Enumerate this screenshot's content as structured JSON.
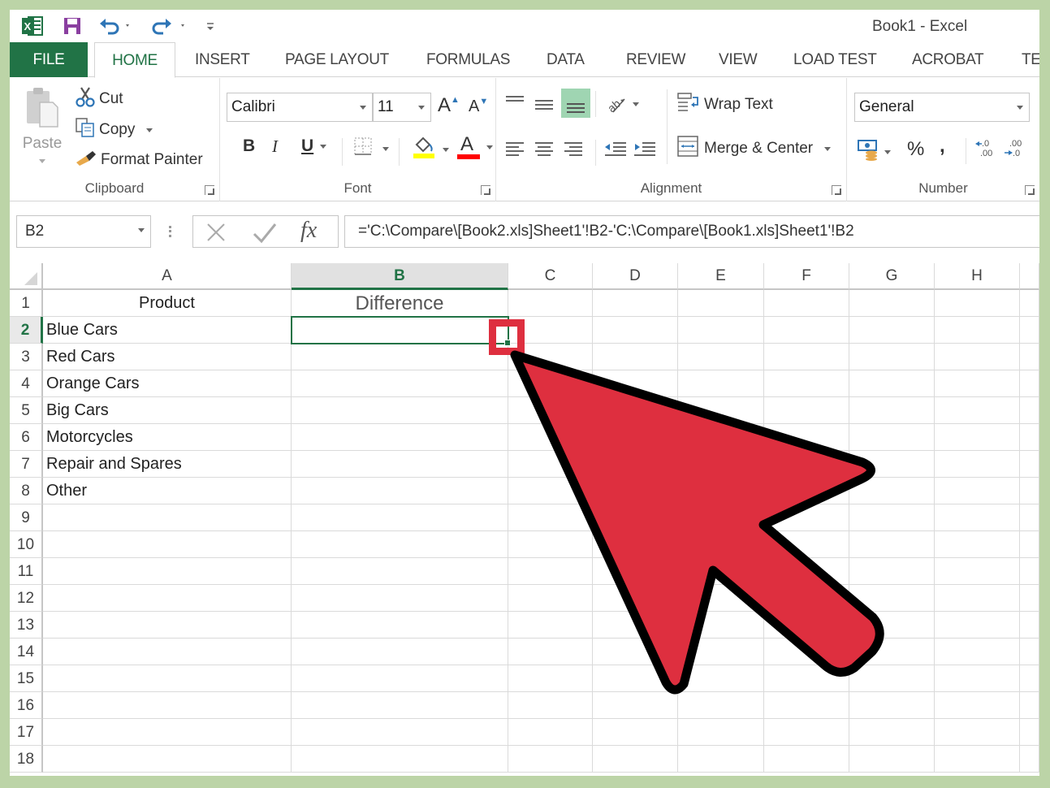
{
  "window": {
    "title": "Book1 - Excel"
  },
  "quick_access": {
    "app_icon": "excel-logo-icon",
    "items": [
      {
        "name": "save-icon"
      },
      {
        "name": "undo-icon"
      },
      {
        "name": "redo-icon"
      },
      {
        "name": "customize-qat-icon"
      }
    ]
  },
  "tabs": [
    {
      "label": "FILE"
    },
    {
      "label": "HOME",
      "active": true
    },
    {
      "label": "INSERT"
    },
    {
      "label": "PAGE LAYOUT"
    },
    {
      "label": "FORMULAS"
    },
    {
      "label": "DATA"
    },
    {
      "label": "REVIEW"
    },
    {
      "label": "VIEW"
    },
    {
      "label": "LOAD TEST"
    },
    {
      "label": "ACROBAT"
    },
    {
      "label": "TE"
    }
  ],
  "ribbon": {
    "clipboard": {
      "label": "Clipboard",
      "paste": "Paste",
      "cut": "Cut",
      "copy": "Copy",
      "format_painter": "Format Painter"
    },
    "font": {
      "label": "Font",
      "font_name": "Calibri",
      "font_size": "11",
      "bold": "B",
      "italic": "I",
      "underline": "U",
      "grow": "A",
      "shrink": "A",
      "font_color": "A",
      "highlight_color": "#ffff00",
      "text_color": "#ff0000"
    },
    "alignment": {
      "label": "Alignment",
      "wrap_text": "Wrap Text",
      "merge_center": "Merge & Center",
      "active_button": "bottom-align"
    },
    "number": {
      "label": "Number",
      "format": "General",
      "percent": "%",
      "comma": ","
    }
  },
  "formula_bar": {
    "name_box": "B2",
    "fx": "fx",
    "formula": "='C:\\Compare\\[Book2.xls]Sheet1'!B2-'C:\\Compare\\[Book1.xls]Sheet1'!B2"
  },
  "sheet": {
    "columns": [
      "A",
      "B",
      "C",
      "D",
      "E",
      "F",
      "G",
      "H"
    ],
    "selected_column": "B",
    "selected_row": 2,
    "active_cell": "B2",
    "rows": [
      {
        "n": "1",
        "A": "Product",
        "B": "Difference"
      },
      {
        "n": "2",
        "A": "Blue Cars",
        "B": ""
      },
      {
        "n": "3",
        "A": "Red Cars",
        "B": ""
      },
      {
        "n": "4",
        "A": "Orange Cars",
        "B": ""
      },
      {
        "n": "5",
        "A": "Big Cars",
        "B": ""
      },
      {
        "n": "6",
        "A": "Motorcycles",
        "B": ""
      },
      {
        "n": "7",
        "A": "Repair and Spares",
        "B": ""
      },
      {
        "n": "8",
        "A": "Other",
        "B": ""
      },
      {
        "n": "9",
        "A": "",
        "B": ""
      },
      {
        "n": "10",
        "A": "",
        "B": ""
      },
      {
        "n": "11",
        "A": "",
        "B": ""
      },
      {
        "n": "12",
        "A": "",
        "B": ""
      },
      {
        "n": "13",
        "A": "",
        "B": ""
      },
      {
        "n": "14",
        "A": "",
        "B": ""
      },
      {
        "n": "15",
        "A": "",
        "B": ""
      },
      {
        "n": "16",
        "A": "",
        "B": ""
      },
      {
        "n": "17",
        "A": "",
        "B": ""
      },
      {
        "n": "18",
        "A": "",
        "B": ""
      }
    ]
  },
  "annotation": {
    "pointer": "red-arrow-pointer",
    "target": "fill-handle",
    "fill_color": "#de2f3f",
    "outline_color": "#000000"
  },
  "colors": {
    "excel_green": "#217346",
    "frame_green": "#bcd4a7"
  }
}
